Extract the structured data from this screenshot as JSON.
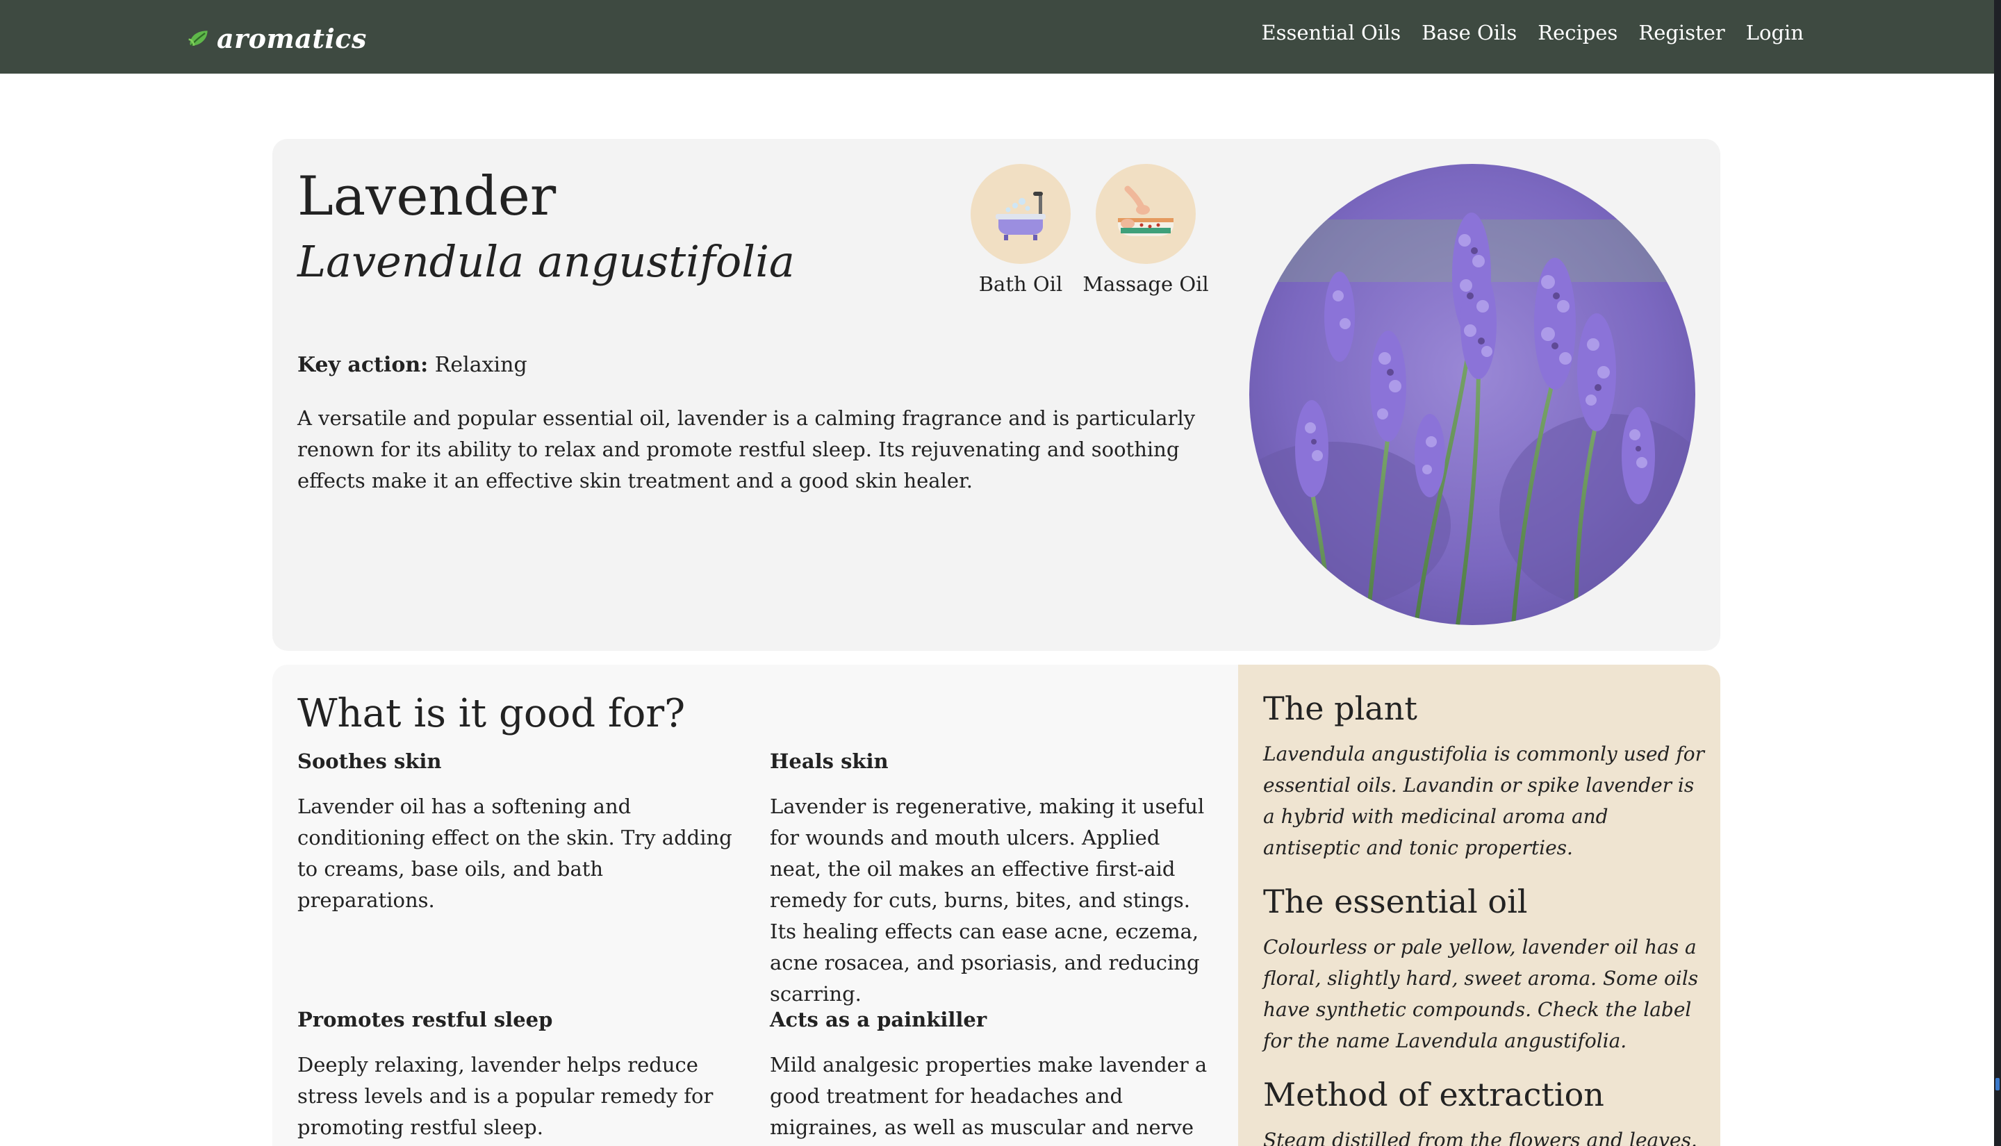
{
  "nav": {
    "brand": "aromatics",
    "links": [
      "Essential Oils",
      "Base Oils",
      "Recipes",
      "Register",
      "Login"
    ]
  },
  "oil": {
    "name": "Lavender",
    "latin": "Lavendula angustifolia",
    "uses": [
      {
        "label": "Bath Oil",
        "icon": "bathtub-icon"
      },
      {
        "label": "Massage Oil",
        "icon": "massage-icon"
      }
    ],
    "key_action_label": "Key action:",
    "key_action_value": "Relaxing",
    "description": "A versatile and popular essential oil, lavender is a calming fragrance and is particularly renown for its ability to relax and promote restful sleep. Its rejuvenating and soothing effects make it an effective skin treatment and a good skin healer."
  },
  "good_for": {
    "title": "What is it good for?",
    "items": [
      {
        "heading": "Soothes skin",
        "text": "Lavender oil has a softening and conditioning effect on the skin. Try adding to creams, base oils, and bath preparations."
      },
      {
        "heading": "Heals skin",
        "text": "Lavender is regenerative, making it useful for wounds and mouth ulcers. Applied neat, the oil makes an effective first-aid remedy for cuts, burns, bites, and stings. Its healing effects can ease acne, eczema, acne rosacea, and psoriasis, and reducing scarring."
      },
      {
        "heading": "Promotes restful sleep",
        "text": "Deeply relaxing, lavender helps reduce stress levels and is a popular remedy for promoting restful sleep."
      },
      {
        "heading": "Acts as a painkiller",
        "text": "Mild analgesic properties make lavender a good treatment for headaches and migraines, as well as muscular and nerve pain. As an anti-"
      }
    ]
  },
  "plant": {
    "plant_title": "The plant",
    "plant_text": "Lavendula angustifolia is commonly used for essential oils. Lavandin or spike lavender is a hybrid with medicinal aroma and antiseptic and tonic properties.",
    "oil_title": "The essential oil",
    "oil_text": "Colourless or pale yellow, lavender oil has a floral, slightly hard, sweet aroma. Some oils have synthetic compounds. Check the label for the name Lavendula angustifolia.",
    "method_title": "Method of extraction",
    "method_text": "Steam distilled from the flowers and leaves."
  },
  "colors": {
    "navbar": "#3e4a41",
    "hero_bg": "#f3f3f3",
    "sidebar_bg": "#efe4d1",
    "use_circle": "#f1dfc3",
    "lavender": "#8a6fd1"
  }
}
